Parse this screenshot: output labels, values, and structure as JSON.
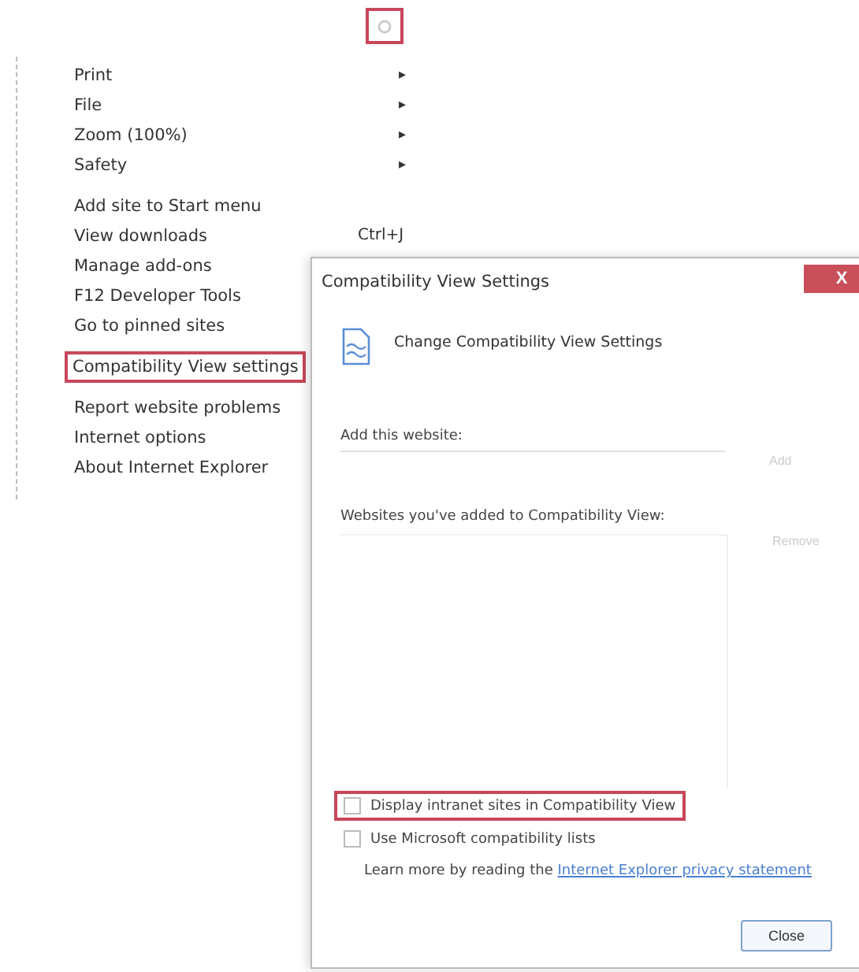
{
  "toolbar": {
    "tools_button": {
      "highlighted": true
    }
  },
  "menu": {
    "groups": [
      [
        {
          "label": "Print",
          "submenu": "▸",
          "highlighted": false
        },
        {
          "label": "File",
          "submenu": "▸",
          "highlighted": false
        },
        {
          "label": "Zoom (100%)",
          "submenu": "▸",
          "highlighted": false
        },
        {
          "label": "Safety",
          "submenu": "▸",
          "highlighted": false
        }
      ],
      [
        {
          "label": "Add site to Start menu",
          "highlighted": false
        },
        {
          "label": "View downloads",
          "shortcut": "Ctrl+J",
          "highlighted": false
        },
        {
          "label": "Manage add-ons",
          "highlighted": false
        },
        {
          "label": "F12 Developer Tools",
          "highlighted": false
        },
        {
          "label": "Go to pinned sites",
          "highlighted": false
        }
      ],
      [
        {
          "label": "Compatibility View settings",
          "highlighted": true
        }
      ],
      [
        {
          "label": "Report website problems",
          "highlighted": false
        },
        {
          "label": "Internet options",
          "highlighted": false
        },
        {
          "label": "About Internet Explorer",
          "highlighted": false
        }
      ]
    ]
  },
  "dialog": {
    "title": "Compatibility View Settings",
    "close": "X",
    "heading": "Change Compatibility View Settings",
    "add_label": "Add this website:",
    "add_button": {
      "label": "Add",
      "disabled": true
    },
    "list_label": "Websites you've added to Compatibility View:",
    "remove_button": {
      "label": "Remove",
      "disabled": true
    },
    "options": [
      {
        "label": "Display intranet sites in Compatibility View",
        "checked": false,
        "highlighted": true
      },
      {
        "label": "Use Microsoft compatibility lists",
        "checked": false,
        "highlighted": false
      }
    ],
    "learn_more": "Learn more by reading the",
    "link": "Internet Explorer privacy statement",
    "close_button": "Close"
  }
}
